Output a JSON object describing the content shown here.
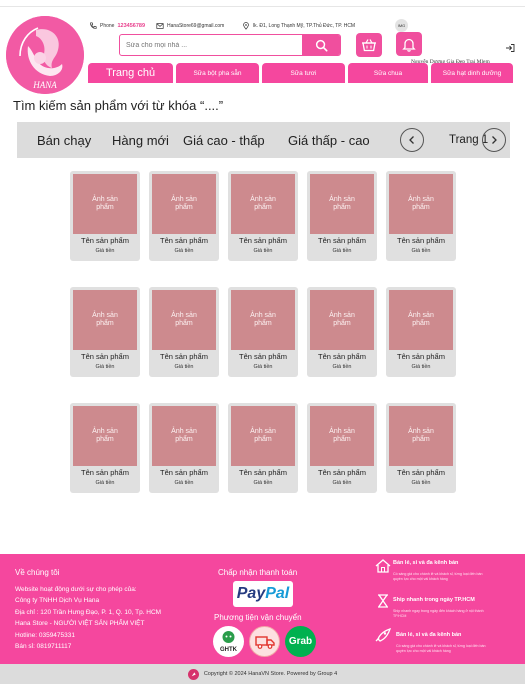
{
  "header": {
    "phone_label": "Phone",
    "phone_value": "123456789",
    "email": "HanaStore69@gmail.com",
    "address": "lk. Đ1, Long Thạnh Mỹ, TP.Thủ Đức, TP. HCM",
    "img_badge": "IMG",
    "user_name": "Nguyễn Dương Gia Đẹp Trai Mlem",
    "logo_text": "HANA"
  },
  "search": {
    "placeholder": "Sửa cho mọi nhà ..."
  },
  "nav": {
    "tabs": [
      {
        "label": "Trang chủ"
      },
      {
        "label": "Sữa bột pha sẵn"
      },
      {
        "label": "Sữa tươi"
      },
      {
        "label": "Sữa chua"
      },
      {
        "label": "Sữa hạt dinh dưỡng"
      }
    ]
  },
  "results": {
    "title": "Tìm kiếm sản phẩm với từ khóa “....”"
  },
  "sort": {
    "options": [
      "Bán chạy",
      "Hàng mới",
      "Giá cao - thấp",
      "Giá thấp - cao"
    ],
    "page_label": "Trang 1"
  },
  "products": [
    {
      "image": "Ảnh sản phẩm",
      "name": "Tên sản phẩm",
      "price": "Giá tiền"
    },
    {
      "image": "Ảnh sản phẩm",
      "name": "Tên sản phẩm",
      "price": "Giá tiền"
    },
    {
      "image": "Ảnh sản phẩm",
      "name": "Tên sản phẩm",
      "price": "Giá tiền"
    },
    {
      "image": "Ảnh sản phẩm",
      "name": "Tên sản phẩm",
      "price": "Giá tiền"
    },
    {
      "image": "Ảnh sản phẩm",
      "name": "Tên sản phẩm",
      "price": "Giá tiền"
    },
    {
      "image": "Ảnh sản phẩm",
      "name": "Tên sản phẩm",
      "price": "Giá tiền"
    },
    {
      "image": "Ảnh sản phẩm",
      "name": "Tên sản phẩm",
      "price": "Giá tiền"
    },
    {
      "image": "Ảnh sản phẩm",
      "name": "Tên sản phẩm",
      "price": "Giá tiền"
    },
    {
      "image": "Ảnh sản phẩm",
      "name": "Tên sản phẩm",
      "price": "Giá tiền"
    },
    {
      "image": "Ảnh sản phẩm",
      "name": "Tên sản phẩm",
      "price": "Giá tiền"
    },
    {
      "image": "Ảnh sản phẩm",
      "name": "Tên sản phẩm",
      "price": "Giá tiền"
    },
    {
      "image": "Ảnh sản phẩm",
      "name": "Tên sản phẩm",
      "price": "Giá tiền"
    },
    {
      "image": "Ảnh sản phẩm",
      "name": "Tên sản phẩm",
      "price": "Giá tiền"
    },
    {
      "image": "Ảnh sản phẩm",
      "name": "Tên sản phẩm",
      "price": "Giá tiền"
    },
    {
      "image": "Ảnh sản phẩm",
      "name": "Tên sản phẩm",
      "price": "Giá tiền"
    }
  ],
  "footer": {
    "about_title": "Về chúng tôi",
    "about_lines": [
      "Website hoạt động dưới sự cho phép của:",
      "Công ty TNHH Dịch Vụ Hana",
      "Địa chỉ : 120 Trần Hưng Đạo, P. 1, Q. 10, Tp. HCM",
      "Hana Store - NGƯỜI VIỆT SẢN PHẨM VIỆT",
      "Hotline: 0359475331",
      "Bán sỉ: 0819711117"
    ],
    "payment_title": "Chấp nhận thanh toán",
    "paypal_a": "Pay",
    "paypal_b": "Pal",
    "shipping_title": "Phương tiện vận chuyển",
    "shipping_ghtk": "GHTK",
    "shipping_grab": "Grab",
    "features": [
      {
        "title": "Bán lẻ, sỉ và đa kênh bán",
        "desc": "Có sáng giá cho chánh lẻ và khách sỉ, từng loại đến bán quyền lực cho một vài khách hàng"
      },
      {
        "title": "Ship nhanh trong ngày TP.HCM",
        "desc": "Ship nhanh ngay trong ngày đến khách hàng ở nội thành TP.HCM"
      },
      {
        "title": "Bán lẻ, sỉ và đa kênh bán",
        "desc": "Có sáng giá cho chánh lẻ và khách sỉ, từng loại đến bán quyền lực cho một vài khách hàng"
      }
    ],
    "copyright": "Copyright © 2024 HanaVN Store. Powered by Group 4"
  },
  "colors": {
    "brand_pink": "#f5479e",
    "product_placeholder": "#cd8a8e",
    "card_bg": "#e0e0e0",
    "sort_bar_bg": "#dcdcdc"
  }
}
